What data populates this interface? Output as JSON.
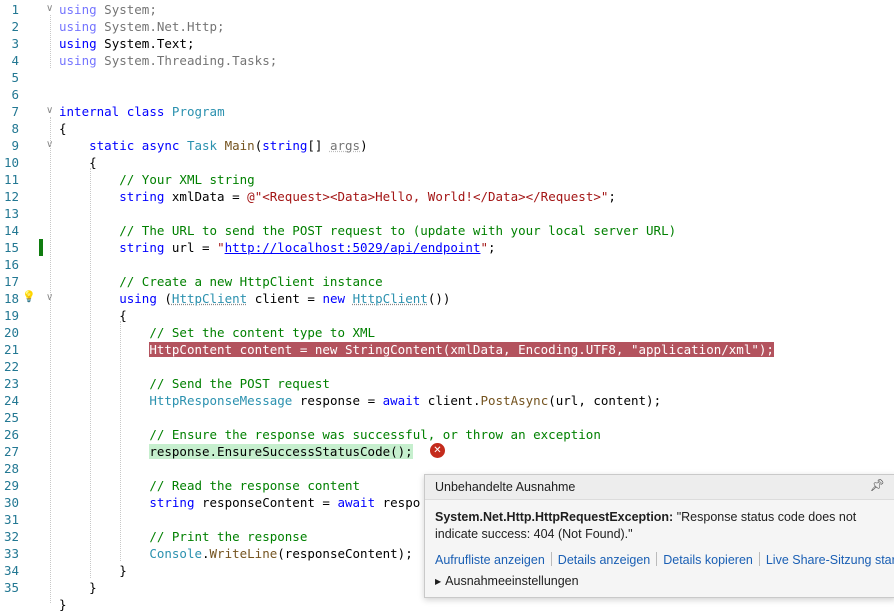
{
  "editor": {
    "lines": [
      {
        "n": "1",
        "t": [
          {
            "c": "kw dim",
            "v": "using"
          },
          {
            "c": "dim",
            "v": " System;"
          }
        ]
      },
      {
        "n": "2",
        "t": [
          {
            "c": "kw dim",
            "v": "using"
          },
          {
            "c": "dim",
            "v": " System.Net.Http;"
          }
        ]
      },
      {
        "n": "3",
        "t": [
          {
            "c": "kw",
            "v": "using"
          },
          {
            "c": "",
            "v": " System.Text;"
          }
        ]
      },
      {
        "n": "4",
        "t": [
          {
            "c": "kw dim",
            "v": "using"
          },
          {
            "c": "dim",
            "v": " System.Threading.Tasks;"
          }
        ]
      },
      {
        "n": "5",
        "t": []
      },
      {
        "n": "6",
        "t": []
      },
      {
        "n": "7",
        "t": [
          {
            "c": "kw",
            "v": "internal"
          },
          {
            "c": "",
            "v": " "
          },
          {
            "c": "kw",
            "v": "class"
          },
          {
            "c": "",
            "v": " "
          },
          {
            "c": "ty",
            "v": "Program"
          }
        ]
      },
      {
        "n": "8",
        "t": [
          {
            "c": "",
            "v": "{"
          }
        ]
      },
      {
        "n": "9",
        "t": [
          {
            "c": "",
            "v": "    "
          },
          {
            "c": "kw",
            "v": "static"
          },
          {
            "c": "",
            "v": " "
          },
          {
            "c": "kw",
            "v": "async"
          },
          {
            "c": "",
            "v": " "
          },
          {
            "c": "ty",
            "v": "Task"
          },
          {
            "c": "",
            "v": " "
          },
          {
            "c": "fn",
            "v": "Main"
          },
          {
            "c": "",
            "v": "("
          },
          {
            "c": "kw",
            "v": "string"
          },
          {
            "c": "",
            "v": "[] "
          },
          {
            "c": "dim ul",
            "v": "args"
          },
          {
            "c": "",
            "v": ")"
          }
        ]
      },
      {
        "n": "10",
        "t": [
          {
            "c": "",
            "v": "    {"
          }
        ]
      },
      {
        "n": "11",
        "t": [
          {
            "c": "",
            "v": "        "
          },
          {
            "c": "cm",
            "v": "// Your XML string"
          }
        ]
      },
      {
        "n": "12",
        "t": [
          {
            "c": "",
            "v": "        "
          },
          {
            "c": "kw",
            "v": "string"
          },
          {
            "c": "",
            "v": " xmlData = "
          },
          {
            "c": "st",
            "v": "@\"<Request><Data>Hello, World!</Data></Request>\""
          },
          {
            "c": "",
            "v": ";"
          }
        ]
      },
      {
        "n": "13",
        "t": []
      },
      {
        "n": "14",
        "t": [
          {
            "c": "",
            "v": "        "
          },
          {
            "c": "cm",
            "v": "// The URL to send the POST request to (update with your local server URL)"
          }
        ]
      },
      {
        "n": "15",
        "t": [
          {
            "c": "",
            "v": "        "
          },
          {
            "c": "kw",
            "v": "string"
          },
          {
            "c": "",
            "v": " url = "
          },
          {
            "c": "st",
            "v": "\""
          },
          {
            "c": "lnk",
            "v": "http://localhost:5029/api/endpoint"
          },
          {
            "c": "st",
            "v": "\""
          },
          {
            "c": "",
            "v": ";"
          }
        ]
      },
      {
        "n": "16",
        "t": []
      },
      {
        "n": "17",
        "t": [
          {
            "c": "",
            "v": "        "
          },
          {
            "c": "cm",
            "v": "// Create a new HttpClient instance"
          }
        ]
      },
      {
        "n": "18",
        "t": [
          {
            "c": "",
            "v": "        "
          },
          {
            "c": "kw",
            "v": "using"
          },
          {
            "c": "",
            "v": " ("
          },
          {
            "c": "ty ul",
            "v": "HttpClient"
          },
          {
            "c": "",
            "v": " client = "
          },
          {
            "c": "kw",
            "v": "new"
          },
          {
            "c": "",
            "v": " "
          },
          {
            "c": "ty ul",
            "v": "HttpClient"
          },
          {
            "c": "",
            "v": "())"
          }
        ]
      },
      {
        "n": "19",
        "t": [
          {
            "c": "",
            "v": "        {"
          }
        ]
      },
      {
        "n": "20",
        "t": [
          {
            "c": "",
            "v": "            "
          },
          {
            "c": "cm",
            "v": "// Set the content type to XML"
          }
        ]
      },
      {
        "n": "21",
        "t": [
          {
            "c": "",
            "v": "            "
          },
          {
            "c": "hl-red",
            "v": "HttpContent content = new StringContent(xmlData, Encoding.UTF8, \"application/xml\");"
          }
        ]
      },
      {
        "n": "22",
        "t": []
      },
      {
        "n": "23",
        "t": [
          {
            "c": "",
            "v": "            "
          },
          {
            "c": "cm",
            "v": "// Send the POST request"
          }
        ]
      },
      {
        "n": "24",
        "t": [
          {
            "c": "",
            "v": "            "
          },
          {
            "c": "ty",
            "v": "HttpResponseMessage"
          },
          {
            "c": "",
            "v": " response = "
          },
          {
            "c": "kw",
            "v": "await"
          },
          {
            "c": "",
            "v": " client."
          },
          {
            "c": "fn",
            "v": "PostAsync"
          },
          {
            "c": "",
            "v": "(url, content);"
          }
        ]
      },
      {
        "n": "25",
        "t": []
      },
      {
        "n": "26",
        "t": [
          {
            "c": "",
            "v": "            "
          },
          {
            "c": "cm",
            "v": "// Ensure the response was successful, or throw an exception"
          }
        ]
      },
      {
        "n": "27",
        "t": [
          {
            "c": "",
            "v": "            "
          },
          {
            "c": "hl-green",
            "v": "response.EnsureSuccessStatusCode();"
          }
        ]
      },
      {
        "n": "28",
        "t": []
      },
      {
        "n": "29",
        "t": [
          {
            "c": "",
            "v": "            "
          },
          {
            "c": "cm",
            "v": "// Read the response content"
          }
        ]
      },
      {
        "n": "30",
        "t": [
          {
            "c": "",
            "v": "            "
          },
          {
            "c": "kw",
            "v": "string"
          },
          {
            "c": "",
            "v": " responseContent = "
          },
          {
            "c": "kw",
            "v": "await"
          },
          {
            "c": "",
            "v": " respo"
          }
        ]
      },
      {
        "n": "31",
        "t": []
      },
      {
        "n": "32",
        "t": [
          {
            "c": "",
            "v": "            "
          },
          {
            "c": "cm",
            "v": "// Print the response"
          }
        ]
      },
      {
        "n": "33",
        "t": [
          {
            "c": "",
            "v": "            "
          },
          {
            "c": "ty",
            "v": "Console"
          },
          {
            "c": "",
            "v": "."
          },
          {
            "c": "fn",
            "v": "WriteLine"
          },
          {
            "c": "",
            "v": "(responseContent);"
          }
        ]
      },
      {
        "n": "34",
        "t": [
          {
            "c": "",
            "v": "        }"
          }
        ]
      },
      {
        "n": "35",
        "t": [
          {
            "c": "",
            "v": "    }"
          }
        ]
      },
      {
        "n": "",
        "t": [
          {
            "c": "",
            "v": "}"
          }
        ]
      }
    ]
  },
  "exception_popup": {
    "title": "Unbehandelte Ausnahme",
    "pin_icon": "pin-icon",
    "exception_type": "System.Net.Http.HttpRequestException:",
    "message": " \"Response status code does not indicate success: 404 (Not Found).\"",
    "links": [
      "Aufrufliste anzeigen",
      "Details anzeigen",
      "Details kopieren",
      "Live Share-Sitzung starten"
    ],
    "settings_label": "Ausnahmeeinstellungen"
  }
}
